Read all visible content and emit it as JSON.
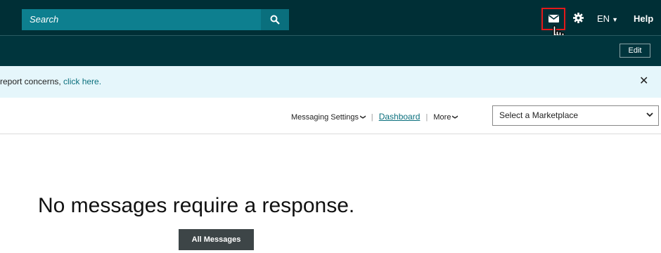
{
  "header": {
    "search_placeholder": "Search",
    "language": "EN",
    "help_label": "Help"
  },
  "subheader": {
    "edit_label": "Edit"
  },
  "banner": {
    "text_prefix": "report concerns, ",
    "link_text": "click here.",
    "close_glyph": "✕"
  },
  "nav": {
    "messaging_settings": "Messaging Settings",
    "separator": "|",
    "dashboard": "Dashboard",
    "more": "More",
    "marketplace_placeholder": "Select a Marketplace"
  },
  "main": {
    "headline": "No messages require a response.",
    "all_messages_button": "All Messages"
  },
  "colors": {
    "header_bg": "#002f36",
    "search_bg": "#0d7f8f",
    "banner_bg": "#e5f6fb",
    "highlight": "#e3191a",
    "button_dark": "#3d4547"
  },
  "icons": [
    "search-icon",
    "mail-icon",
    "gear-icon",
    "hand-cursor-icon",
    "chevron-down-icon",
    "close-icon"
  ]
}
